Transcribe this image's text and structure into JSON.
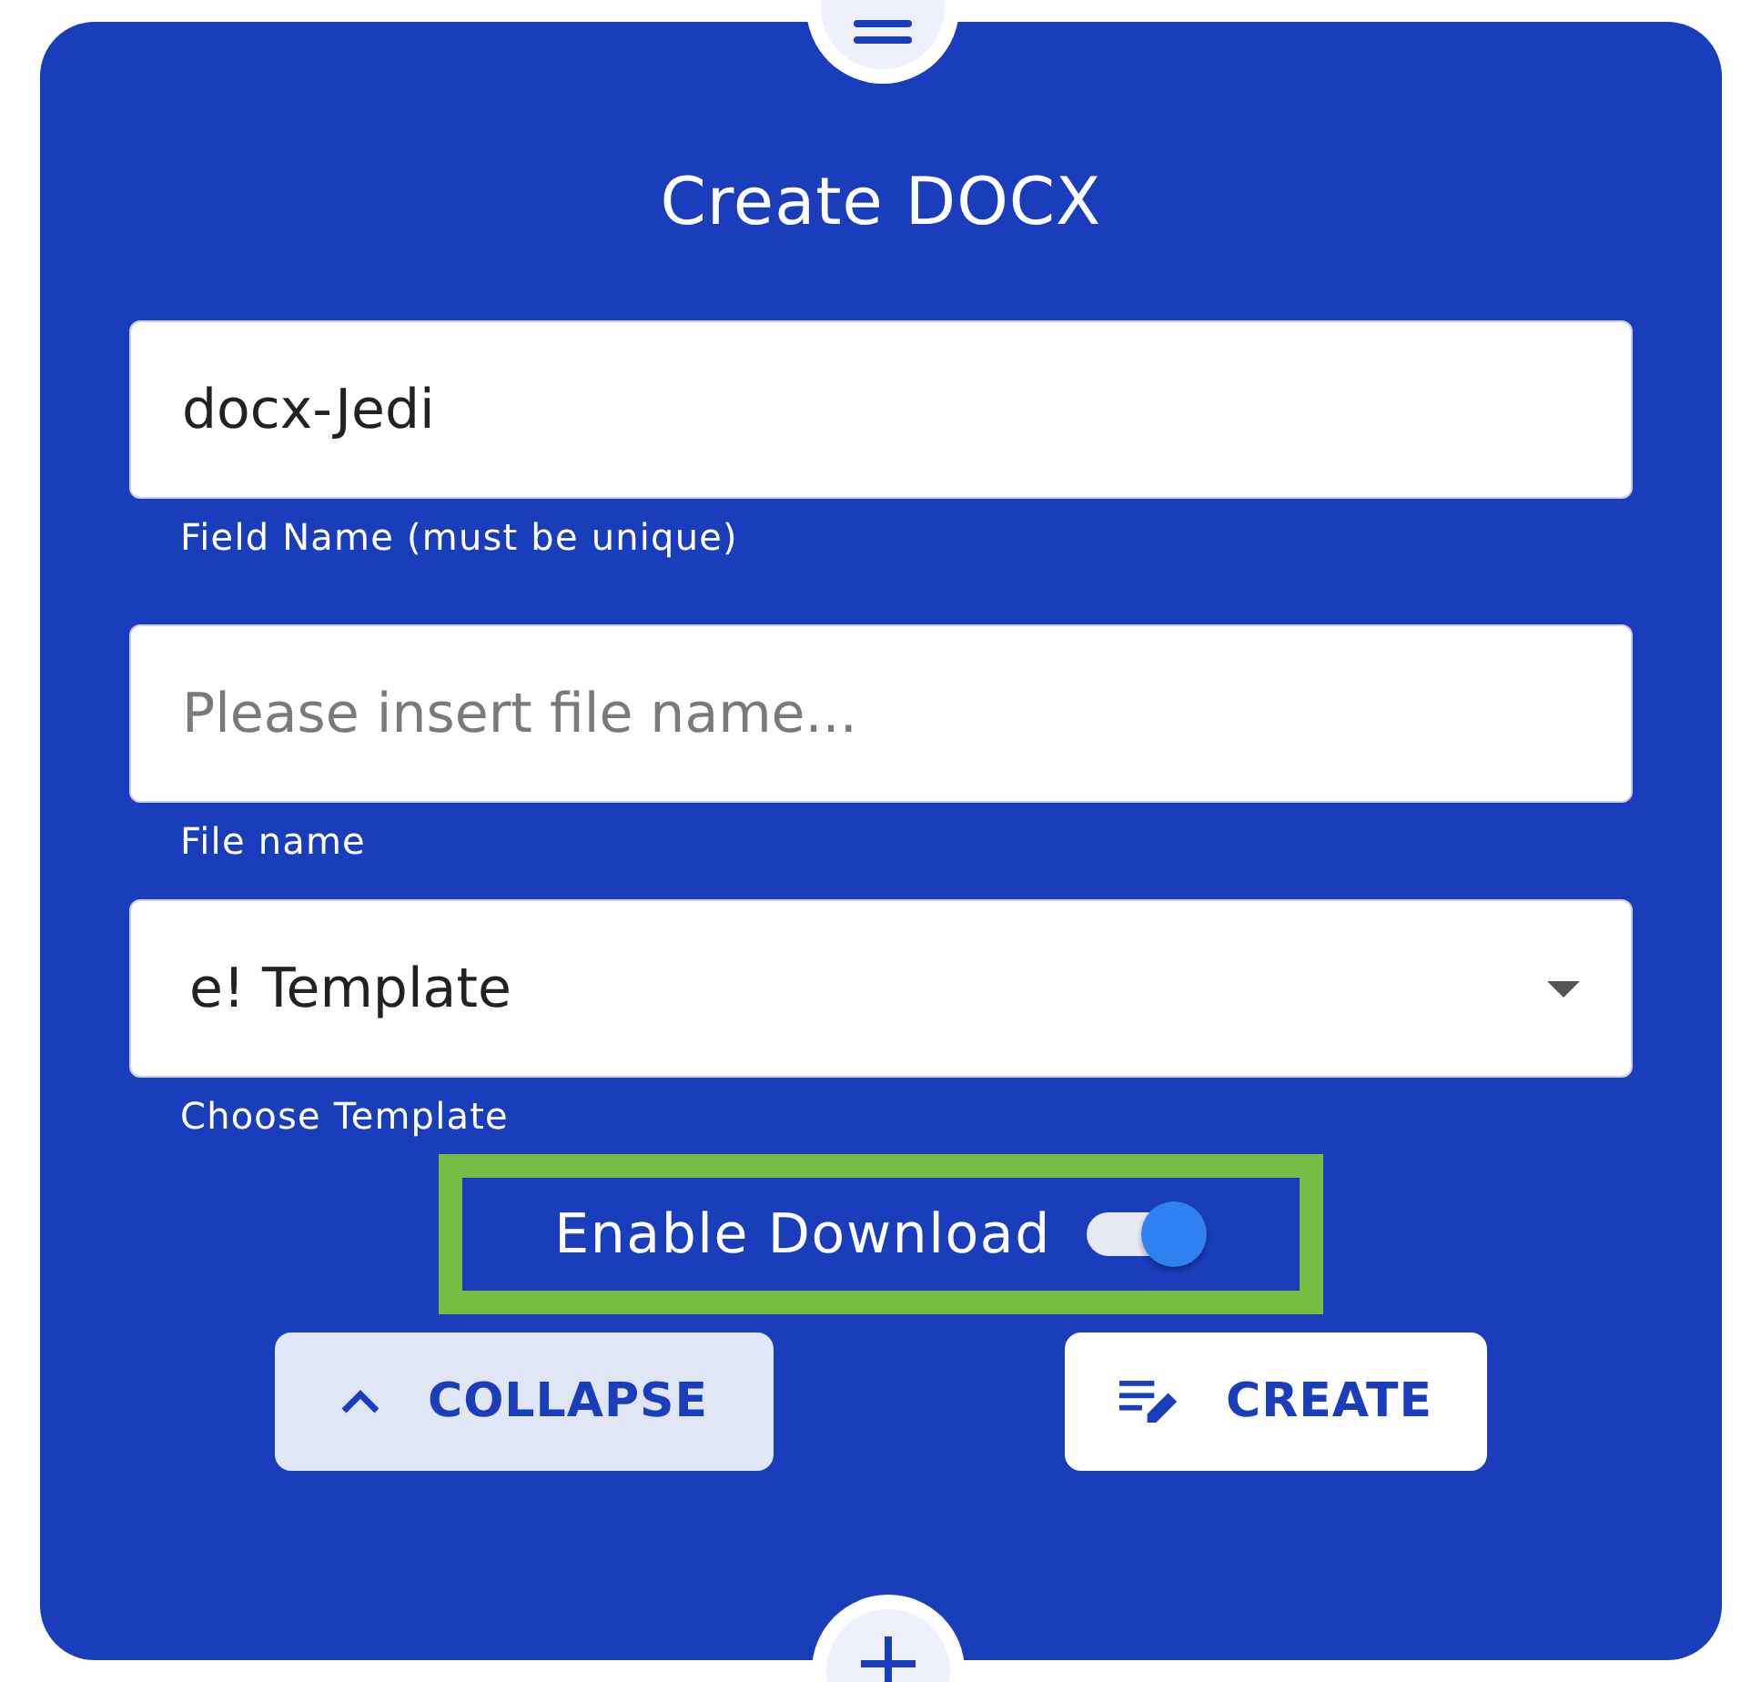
{
  "title": "Create DOCX",
  "fields": [
    {
      "kind": "text",
      "value": "docx-Jedi",
      "helper": "Field Name (must be unique)"
    },
    {
      "kind": "text",
      "placeholder": "Please insert file name...",
      "helper": "File name"
    },
    {
      "kind": "select",
      "value": "e! Template",
      "helper": "Choose Template"
    }
  ],
  "toggle": {
    "label": "Enable Download",
    "on": true,
    "highlighted": true
  },
  "buttons": [
    {
      "kind": "collapse",
      "label": "COLLAPSE"
    },
    {
      "kind": "create",
      "label": "CREATE"
    }
  ]
}
